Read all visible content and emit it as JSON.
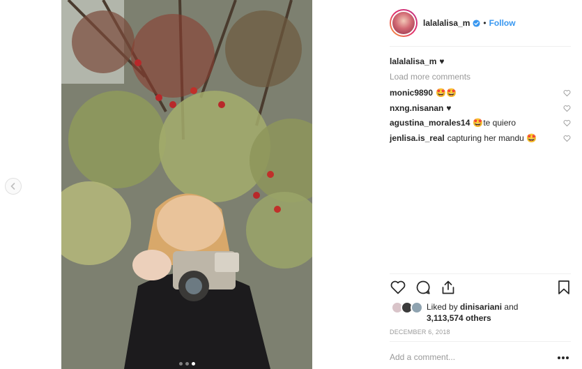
{
  "colors": {
    "accent_blue": "#3897f0",
    "text": "#262626",
    "muted": "#999999",
    "divider": "#efefef",
    "emoji": "#f7c53b"
  },
  "nav": {
    "prev_icon": "chevron-left-icon"
  },
  "carousel": {
    "total": 3,
    "active": 3
  },
  "post": {
    "username": "lalalalisa_m",
    "verified_icon": "verified-badge-icon",
    "separator": "•",
    "follow_label": "Follow"
  },
  "caption": {
    "user": "lalalalisa_m",
    "text": "♥"
  },
  "load_more": "Load more comments",
  "comments": [
    {
      "user": "monic9890",
      "text": "🤩🤩"
    },
    {
      "user": "nxng.nisanan",
      "text": "♥"
    },
    {
      "user": "agustina_morales14",
      "text": "🤩te quiero"
    },
    {
      "user": "jenlisa.is_real",
      "text": "capturing her mandu 🤩"
    }
  ],
  "actions": {
    "like_icon": "heart-icon",
    "comment_icon": "comment-icon",
    "share_icon": "share-icon",
    "save_icon": "bookmark-icon"
  },
  "likes": {
    "prefix": "Liked by",
    "user": "dinisariani",
    "and": "and",
    "count": "3,113,574 others"
  },
  "date": "DECEMBER 6, 2018",
  "add_comment_placeholder": "Add a comment...",
  "more_icon": "more-options-icon"
}
